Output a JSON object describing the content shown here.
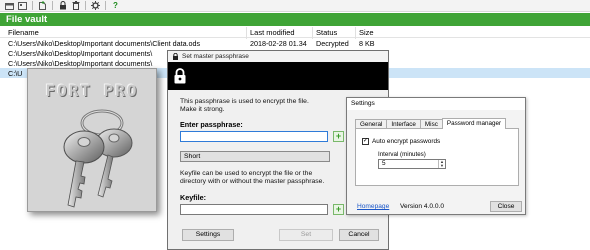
{
  "toolbar": {
    "icons": [
      "open-icon",
      "new-vault-icon",
      "add-file-icon",
      "lock-icon",
      "delete-icon",
      "settings-icon",
      "help-icon"
    ],
    "help_label": "?"
  },
  "vault": {
    "title": "File vault",
    "columns": {
      "filename": "Filename",
      "modified": "Last modified",
      "status": "Status",
      "size": "Size"
    },
    "rows": [
      {
        "filename": "C:\\Users\\Niko\\Desktop\\Important documents\\Client data.ods",
        "modified": "2018-02-28 01.34",
        "status": "Decrypted",
        "size": "8 KB"
      },
      {
        "filename": "C:\\Users\\Niko\\Desktop\\Important documents\\",
        "modified": "",
        "status": "",
        "size": ""
      },
      {
        "filename": "C:\\Users\\Niko\\Desktop\\Important documents\\",
        "modified": "",
        "status": "",
        "size": ""
      },
      {
        "filename": "C:\\U",
        "modified": "",
        "status": "",
        "size": ""
      }
    ]
  },
  "logo": {
    "text": "FORT PRO"
  },
  "passphrase_dialog": {
    "title": "Set master passphrase",
    "info_line1": "This passphrase is used to encrypt the file.",
    "info_line2": "Make it strong.",
    "enter_label": "Enter passphrase:",
    "passphrase_value": "",
    "strength": "Short",
    "keyfile_info_line1": "Keyfile can be used to encrypt the file or the",
    "keyfile_info_line2": "directory with or without the master passphrase.",
    "keyfile_label": "Keyfile:",
    "keyfile_value": "",
    "plus_label": "+",
    "settings_button": "Settings",
    "set_button": "Set",
    "cancel_button": "Cancel"
  },
  "settings_dialog": {
    "title": "Settings",
    "tabs": [
      "General",
      "Interface",
      "Misc",
      "Password manager"
    ],
    "active_tab": "Password manager",
    "auto_encrypt_label": "Auto encrypt passwords",
    "auto_encrypt_checked": true,
    "check_mark": "✓",
    "interval_label": "Interval (minutes)",
    "interval_value": "5",
    "homepage_link": "Homepage",
    "version": "Version 4.0.0.0",
    "close_button": "Close"
  },
  "colors": {
    "vault_header": "#3fa436",
    "selected_row": "#cce4f7",
    "link": "#1a56c8"
  }
}
